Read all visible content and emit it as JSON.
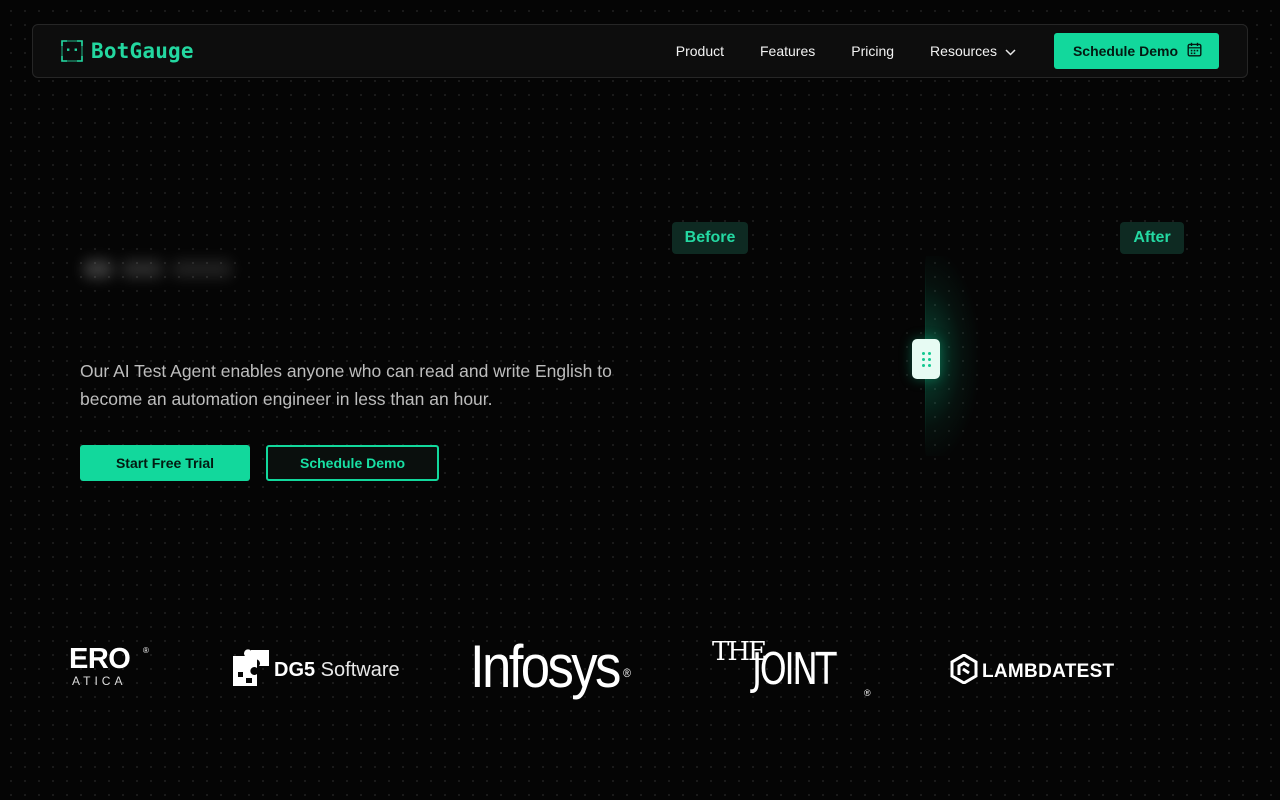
{
  "nav": {
    "brand": "BotGauge",
    "links": [
      "Product",
      "Features",
      "Pricing",
      "Resources"
    ],
    "cta": "Schedule Demo"
  },
  "hero": {
    "description": "Our AI Test Agent enables anyone who can read and write English to become an automation engineer in less than an hour.",
    "primary_button": "Start Free Trial",
    "secondary_button": "Schedule Demo"
  },
  "compare": {
    "before_label": "Before",
    "after_label": "After"
  },
  "logos": {
    "zero_big": "ERO",
    "zero_small": "ATICA",
    "dg5_bold": "DG5",
    "dg5_rest": " Software",
    "infosys": "Infosys",
    "joint_the": "THE",
    "joint_main": "JOINT",
    "lambda": "LAMBDATEST",
    "registered": "®"
  },
  "colors": {
    "accent": "#12d89c",
    "background": "#050505",
    "tag_background": "#0e2a22"
  },
  "icons": [
    "bot-logo-icon",
    "chevron-down-icon",
    "calendar-icon",
    "drag-handle-icon",
    "puzzle-icon",
    "lambdatest-icon"
  ]
}
